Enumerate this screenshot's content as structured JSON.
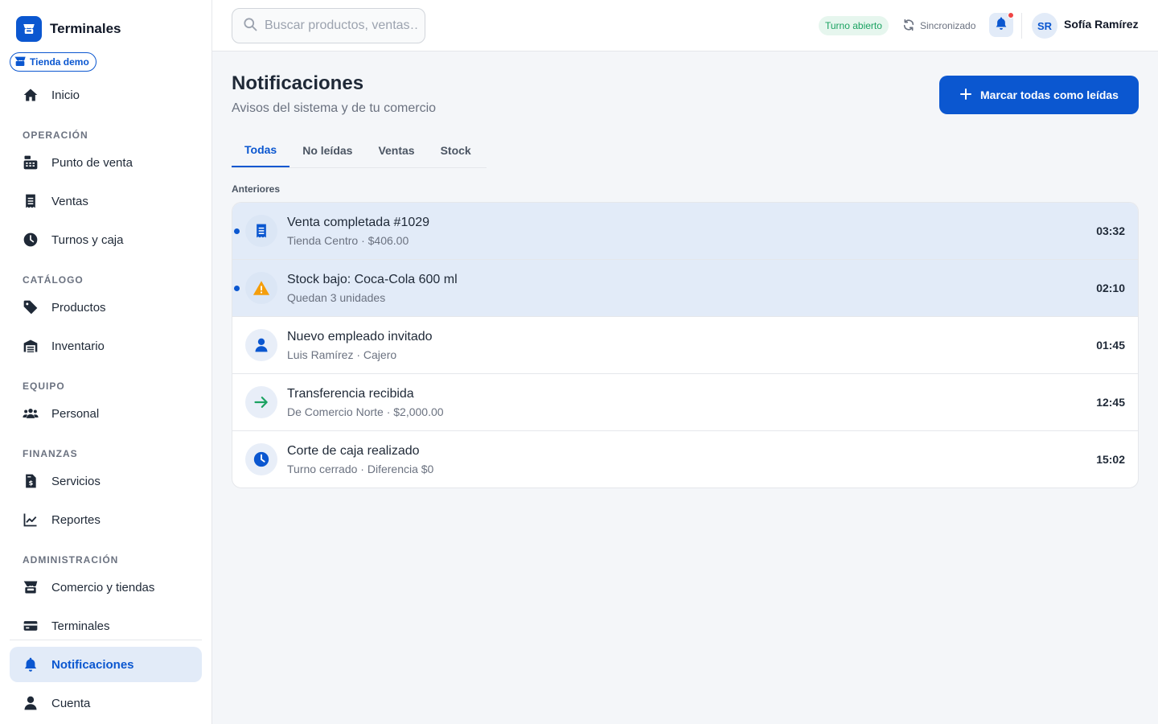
{
  "app": {
    "name": "Terminales",
    "store": "Tienda demo"
  },
  "sidebar": {
    "items": [
      {
        "label": "Inicio",
        "icon": "home-icon"
      },
      {
        "label": "Punto de venta",
        "icon": "cash-register-icon"
      },
      {
        "label": "Ventas",
        "icon": "receipt-icon"
      },
      {
        "label": "Turnos y caja",
        "icon": "clock-icon"
      },
      {
        "label": "Productos",
        "icon": "tag-icon"
      },
      {
        "label": "Inventario",
        "icon": "warehouse-icon"
      },
      {
        "label": "Personal",
        "icon": "users-icon"
      },
      {
        "label": "Servicios",
        "icon": "invoice-dollar-icon"
      },
      {
        "label": "Reportes",
        "icon": "chart-line-icon"
      },
      {
        "label": "Comercio y tiendas",
        "icon": "store-icon"
      },
      {
        "label": "Terminales",
        "icon": "card-icon"
      },
      {
        "label": "Notificaciones",
        "icon": "bell-icon"
      },
      {
        "label": "Cuenta",
        "icon": "user-icon"
      }
    ],
    "sections": [
      "OPERACIÓN",
      "CATÁLOGO",
      "EQUIPO",
      "FINANZAS",
      "ADMINISTRACIÓN"
    ],
    "active": "Notificaciones"
  },
  "topbar": {
    "search_placeholder": "Buscar productos, ventas…",
    "shift_status": "Turno abierto",
    "sync_status": "Sincronizado",
    "user_initials": "SR",
    "user_name": "Sofía Ramírez"
  },
  "page": {
    "title": "Notificaciones",
    "subtitle": "Avisos del sistema y de tu comercio",
    "mark_all_label": "Marcar todas como leídas",
    "tabs": [
      "Todas",
      "No leídas",
      "Ventas",
      "Stock"
    ],
    "active_tab": "Todas",
    "group_label": "Anteriores"
  },
  "notifications": [
    {
      "title": "Venta completada #1029",
      "subtitle": "Tienda Centro · $406.00",
      "time": "03:32",
      "unread": true,
      "icon": "receipt-icon"
    },
    {
      "title": "Stock bajo: Coca-Cola 600 ml",
      "subtitle": "Quedan 3 unidades",
      "time": "02:10",
      "unread": true,
      "icon": "warning-icon"
    },
    {
      "title": "Nuevo empleado invitado",
      "subtitle": "Luis Ramírez · Cajero",
      "time": "01:45",
      "unread": false,
      "icon": "user-icon"
    },
    {
      "title": "Transferencia recibida",
      "subtitle": "De Comercio Norte · $2,000.00",
      "time": "12:45",
      "unread": false,
      "icon": "arrow-right-icon"
    },
    {
      "title": "Corte de caja realizado",
      "subtitle": "Turno cerrado · Diferencia $0",
      "time": "15:02",
      "unread": false,
      "icon": "clock-icon"
    }
  ],
  "colors": {
    "primary": "#0b57d0",
    "success": "#1aa261",
    "warning": "#f59e0b",
    "danger": "#ef4444",
    "unread_bg": "#e2ebf8"
  }
}
